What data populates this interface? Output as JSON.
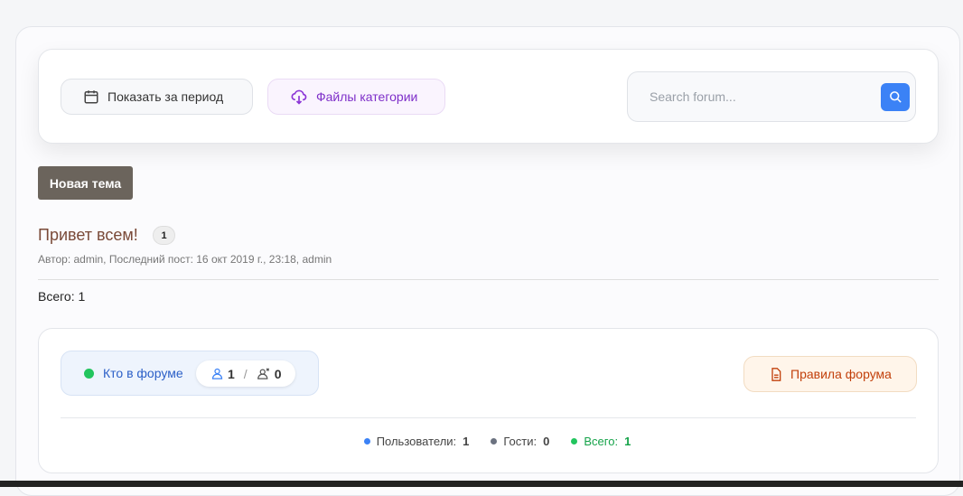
{
  "toolbar": {
    "period_label": "Показать за период",
    "files_label": "Файлы категории",
    "search_placeholder": "Search forum..."
  },
  "new_topic_label": "Новая тема",
  "topics": [
    {
      "title": "Привет всем!",
      "replies": "1",
      "meta": "Автор: admin, Последний пост: 16 окт 2019 г., 23:18, admin"
    }
  ],
  "total_label": "Всего: 1",
  "who": {
    "label": "Кто в форуме",
    "users": "1",
    "separator": "/",
    "guests": "0",
    "rules_label": "Правила форума",
    "stats": [
      {
        "label": "Пользователи:",
        "value": "1",
        "color": "#3b82f6"
      },
      {
        "label": "Гости:",
        "value": "0",
        "color": "#6b7280"
      },
      {
        "label": "Всего:",
        "value": "1",
        "color": "#22c55e"
      }
    ]
  }
}
